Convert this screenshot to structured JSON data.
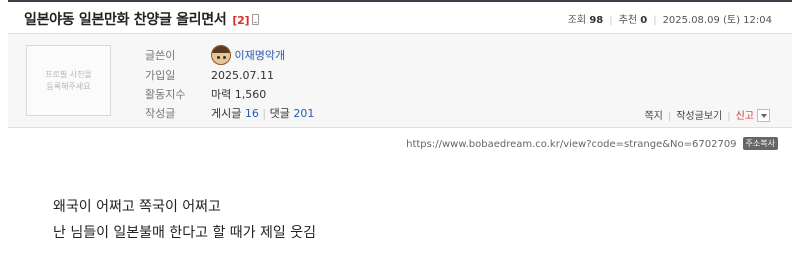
{
  "post": {
    "title": "일본야동 일본만화 찬양글 올리면서",
    "reply_count": "[2]",
    "stats": {
      "views_label": "조회",
      "views": "98",
      "recommend_label": "추천",
      "recommend": "0",
      "date": "2025.08.09 (토) 12:04"
    }
  },
  "author": {
    "photo_placeholder_line1": "프로필 사진을",
    "photo_placeholder_line2": "등록해주세요",
    "writer_label": "글쓴이",
    "writer_name": "이재명악개",
    "joined_label": "가입일",
    "joined_value": "2025.07.11",
    "activity_label": "활동지수",
    "activity_value": "마력 1,560",
    "posts_label": "작성글",
    "posts_prefix": "게시글",
    "posts_count": "16",
    "comments_prefix": "댓글",
    "comments_count": "201",
    "actions": {
      "note": "쪽지",
      "view_posts": "작성글보기",
      "report": "신고"
    }
  },
  "url_bar": {
    "url": "https://www.bobaedream.co.kr/view?code=strange&No=6702709",
    "copy_label": "주소복사"
  },
  "content": {
    "lines": [
      "왜국이 어쩌고 쪽국이 어쩌고",
      "난 님들이 일본불매 한다고 할 때가 제일 웃김"
    ]
  },
  "colors": {
    "title_border": "#3a3f4a",
    "reply_red": "#d8312c",
    "link_blue": "#2a5ab0",
    "author_bg": "#f7f7f7"
  }
}
